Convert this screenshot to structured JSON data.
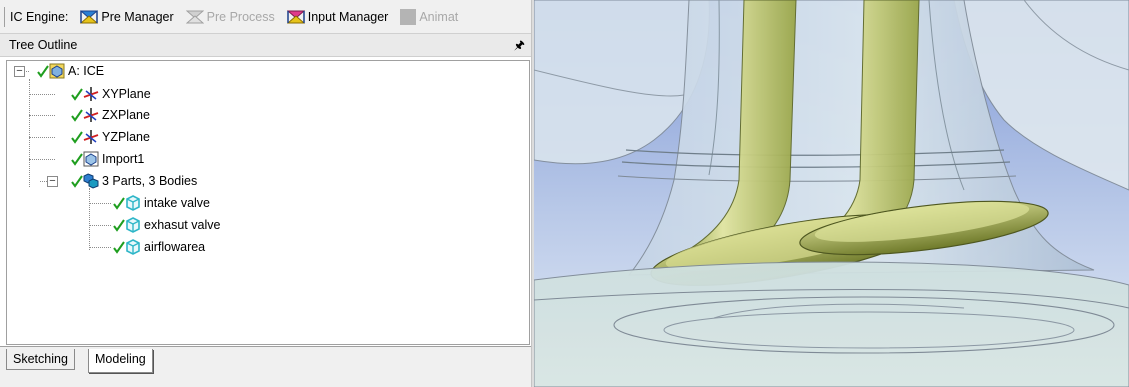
{
  "toolbar": {
    "label": "IC Engine:",
    "pre_manager": "Pre Manager",
    "pre_process": "Pre Process",
    "input_manager": "Input Manager",
    "animate": "Animat"
  },
  "panel": {
    "title": "Tree Outline",
    "pin_icon": "pin-icon"
  },
  "tree": {
    "root": "A: ICE",
    "items": [
      "XYPlane",
      "ZXPlane",
      "YZPlane",
      "Import1"
    ],
    "parts_group": "3 Parts, 3 Bodies",
    "bodies": [
      "intake valve",
      "exhasut valve",
      "airflowarea"
    ]
  },
  "tabs": [
    "Sketching",
    "Modeling"
  ],
  "active_tab": "Modeling",
  "colors": {
    "check": "#1f9e1f",
    "body_icon": "#2eb6c8",
    "valve": "#c8d07a",
    "sky_top": "#8aa0d8",
    "sky_bottom": "#c9d6ec"
  }
}
